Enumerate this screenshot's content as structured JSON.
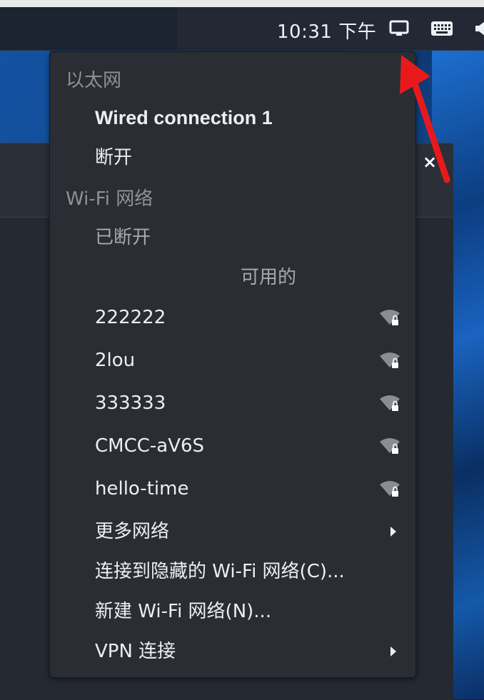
{
  "topbar": {
    "clock": "10:31 下午",
    "icons": [
      "network-icon",
      "keyboard-icon",
      "volume-icon"
    ]
  },
  "background_window": {
    "close_symbol": "×"
  },
  "menu": {
    "ethernet_header": "以太网",
    "wired_connection": "Wired connection 1",
    "disconnect": "断开",
    "wifi_header": "Wi-Fi 网络",
    "wifi_status": "已断开",
    "available_label": "可用的",
    "networks": [
      {
        "ssid": "222222",
        "icon": "wifi-locked-icon"
      },
      {
        "ssid": "2lou",
        "icon": "wifi-locked-icon"
      },
      {
        "ssid": "333333",
        "icon": "wifi-locked-icon"
      },
      {
        "ssid": "CMCC-aV6S",
        "icon": "wifi-locked-icon"
      },
      {
        "ssid": "hello-time",
        "icon": "wifi-locked-icon"
      }
    ],
    "more_networks": "更多网络",
    "connect_hidden": "连接到隐藏的 Wi-Fi 网络(C)...",
    "new_wifi": "新建 Wi-Fi 网络(N)...",
    "vpn": "VPN 连接"
  },
  "colors": {
    "menu_bg": "#2a2d33",
    "topbar_bg": "#232834",
    "annotation_arrow": "#e8191c"
  }
}
